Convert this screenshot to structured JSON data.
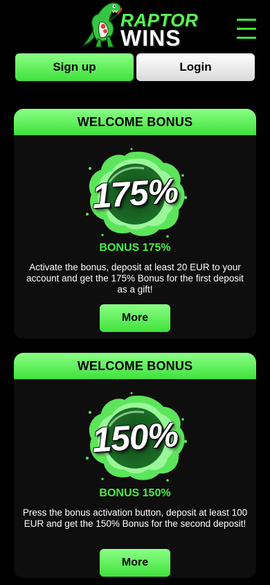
{
  "brand": {
    "logo_line1": "RAPTOR",
    "logo_line2": "WINS"
  },
  "header": {
    "menu_icon": "hamburger-menu-icon"
  },
  "auth": {
    "signup_label": "Sign up",
    "login_label": "Login"
  },
  "bonuses": [
    {
      "header": "WELCOME BONUS",
      "badge": "175%",
      "title": "BONUS 175%",
      "description": "Activate the bonus, deposit at least 20 EUR to your account and get the 175% Bonus for the first deposit as a gift!",
      "button": "More"
    },
    {
      "header": "WELCOME BONUS",
      "badge": "150%",
      "title": "BONUS 150%",
      "description": "Press the bonus activation button, deposit at least 100 EUR and get the 150% Bonus for the second deposit!",
      "button": "More"
    }
  ],
  "colors": {
    "accent": "#47ee45",
    "background": "#000000",
    "card": "#0e0e0e"
  }
}
